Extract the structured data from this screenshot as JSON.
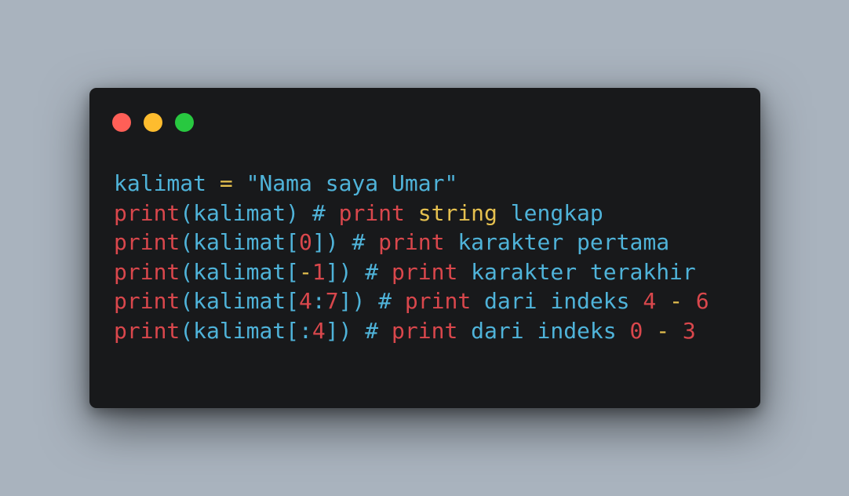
{
  "window": {
    "controls": [
      {
        "name": "close",
        "color": "#ff5f57"
      },
      {
        "name": "minimize",
        "color": "#febc2e"
      },
      {
        "name": "maximize",
        "color": "#28c840"
      }
    ]
  },
  "colors": {
    "background": "#a9b3be",
    "editor_bg": "#18191b",
    "identifier": "#4fb3d9",
    "keyword": "#d9474c",
    "string_word": "#e5c04f",
    "operator": "#e5c04f"
  },
  "code": {
    "lines": [
      [
        {
          "text": "kalimat ",
          "kind": "ident"
        },
        {
          "text": "=",
          "kind": "op"
        },
        {
          "text": " \"Nama saya Umar\"",
          "kind": "ident"
        }
      ],
      [
        {
          "text": "print",
          "kind": "kw"
        },
        {
          "text": "(kalimat) # ",
          "kind": "ident"
        },
        {
          "text": "print",
          "kind": "kw"
        },
        {
          "text": " ",
          "kind": "ident"
        },
        {
          "text": "string",
          "kind": "str"
        },
        {
          "text": " lengkap",
          "kind": "ident"
        }
      ],
      [
        {
          "text": "print",
          "kind": "kw"
        },
        {
          "text": "(kalimat[",
          "kind": "ident"
        },
        {
          "text": "0",
          "kind": "kw"
        },
        {
          "text": "]) # ",
          "kind": "ident"
        },
        {
          "text": "print",
          "kind": "kw"
        },
        {
          "text": " karakter pertama",
          "kind": "ident"
        }
      ],
      [
        {
          "text": "print",
          "kind": "kw"
        },
        {
          "text": "(kalimat[",
          "kind": "ident"
        },
        {
          "text": "-",
          "kind": "op"
        },
        {
          "text": "1",
          "kind": "kw"
        },
        {
          "text": "]) # ",
          "kind": "ident"
        },
        {
          "text": "print",
          "kind": "kw"
        },
        {
          "text": " karakter terakhir",
          "kind": "ident"
        }
      ],
      [
        {
          "text": "print",
          "kind": "kw"
        },
        {
          "text": "(kalimat[",
          "kind": "ident"
        },
        {
          "text": "4",
          "kind": "kw"
        },
        {
          "text": ":",
          "kind": "ident"
        },
        {
          "text": "7",
          "kind": "kw"
        },
        {
          "text": "]) # ",
          "kind": "ident"
        },
        {
          "text": "print",
          "kind": "kw"
        },
        {
          "text": " dari indeks ",
          "kind": "ident"
        },
        {
          "text": "4",
          "kind": "kw"
        },
        {
          "text": " ",
          "kind": "ident"
        },
        {
          "text": "-",
          "kind": "op"
        },
        {
          "text": " ",
          "kind": "ident"
        },
        {
          "text": "6",
          "kind": "kw"
        }
      ],
      [
        {
          "text": "print",
          "kind": "kw"
        },
        {
          "text": "(kalimat[:",
          "kind": "ident"
        },
        {
          "text": "4",
          "kind": "kw"
        },
        {
          "text": "]) # ",
          "kind": "ident"
        },
        {
          "text": "print",
          "kind": "kw"
        },
        {
          "text": " dari indeks ",
          "kind": "ident"
        },
        {
          "text": "0",
          "kind": "kw"
        },
        {
          "text": " ",
          "kind": "ident"
        },
        {
          "text": "-",
          "kind": "op"
        },
        {
          "text": " ",
          "kind": "ident"
        },
        {
          "text": "3",
          "kind": "kw"
        }
      ]
    ]
  }
}
